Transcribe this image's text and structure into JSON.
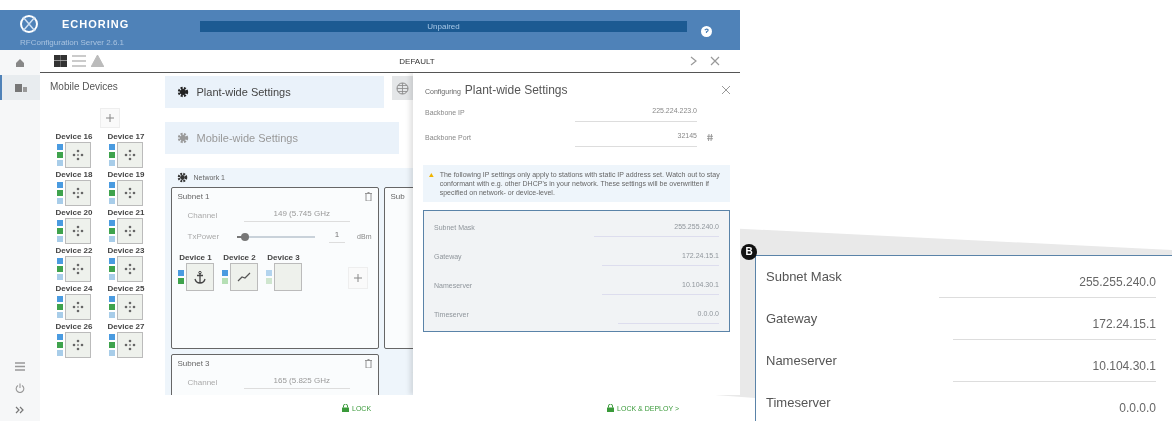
{
  "header": {
    "brand": "ECHORING",
    "subtitle": "RFConfiguration Server 2.6.1",
    "status": "Unpaired"
  },
  "rail": {
    "items": [
      {
        "kind": "home",
        "selected": false
      },
      {
        "kind": "devices",
        "selected": true
      }
    ],
    "bottom": [
      {
        "kind": "menu"
      },
      {
        "kind": "power"
      },
      {
        "kind": "expand"
      }
    ]
  },
  "toolbar": {
    "views": [
      {
        "kind": "grid",
        "selected": true
      },
      {
        "kind": "list",
        "selected": false
      },
      {
        "kind": "warning",
        "selected": false
      }
    ],
    "profile": "DEFAULT"
  },
  "mobile_devices": {
    "title": "Mobile Devices",
    "devices": [
      {
        "name": "Device 16"
      },
      {
        "name": "Device 17"
      },
      {
        "name": "Device 18"
      },
      {
        "name": "Device 19"
      },
      {
        "name": "Device 20"
      },
      {
        "name": "Device 21"
      },
      {
        "name": "Device 22"
      },
      {
        "name": "Device 23"
      },
      {
        "name": "Device 24"
      },
      {
        "name": "Device 25"
      },
      {
        "name": "Device 26"
      },
      {
        "name": "Device 27"
      }
    ]
  },
  "settings": [
    {
      "label": "Plant-wide Settings",
      "selected": true
    },
    {
      "label": "Mobile-wide Settings",
      "selected": false
    }
  ],
  "network": {
    "title": "Network 1",
    "subnets": [
      {
        "title": "Subnet 1",
        "channel_label": "Channel",
        "channel": "149 (5.745 GHz",
        "tx_label": "TxPower",
        "level": 0.1,
        "tx_value": "1",
        "tx_unit": "dBm",
        "devices": [
          {
            "name": "Device 1",
            "kind": "anchor"
          },
          {
            "name": "Device 2",
            "kind": "trend"
          },
          {
            "name": "Device 3",
            "kind": "empty"
          }
        ]
      },
      {
        "title": "Sub"
      },
      {
        "title": "Subnet 3",
        "channel_label": "Channel",
        "channel": "165 (5.825 GHz"
      }
    ]
  },
  "config": {
    "prefix": "Configuring",
    "title": "Plant-wide Settings",
    "fields": [
      {
        "label": "Backbone IP",
        "value": "225.224.223.0"
      },
      {
        "label": "Backbone Port",
        "value": "32145"
      }
    ],
    "notice": "The following IP settings only apply to stations with static IP address set. Watch out to stay conformant with e.g. other DHCP's in your network. These settings will be overwritten if specified on network- or device-level.",
    "ip_fields": [
      {
        "label": "Subnet Mask",
        "value": "255.255.240.0",
        "disabled": true
      },
      {
        "label": "Gateway",
        "value": "172.24.15.1",
        "disabled": true
      },
      {
        "label": "Nameserver",
        "value": "10.104.30.1",
        "disabled": true
      },
      {
        "label": "Timeserver",
        "value": "0.0.0.0",
        "disabled": true
      }
    ]
  },
  "footer": {
    "lock": "LOCK",
    "deploy": "LOCK & DEPLOY >"
  },
  "callout": {
    "badge": "B",
    "fields": [
      {
        "label": "Subnet Mask",
        "value": "255.255.240.0"
      },
      {
        "label": "Gateway",
        "value": "172.24.15.1"
      },
      {
        "label": "Nameserver",
        "value": "10.104.30.1"
      },
      {
        "label": "Timeserver",
        "value": "0.0.0.0"
      }
    ]
  }
}
